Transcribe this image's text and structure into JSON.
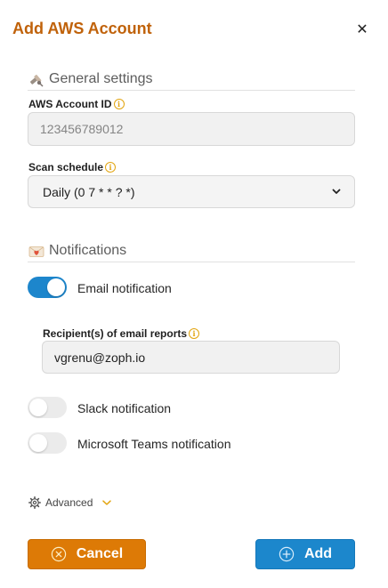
{
  "modal": {
    "title": "Add AWS Account",
    "close_label": "✕"
  },
  "general": {
    "heading": "General settings",
    "icon": "satellite-icon",
    "account_id_label": "AWS Account ID",
    "account_id_value": "123456789012",
    "scan_schedule_label": "Scan schedule",
    "scan_schedule_value": "Daily (0 7 * * ? *)"
  },
  "notifications": {
    "heading": "Notifications",
    "icon": "envelope-heart-icon",
    "email": {
      "label": "Email notification",
      "enabled": true
    },
    "recipients_label": "Recipient(s) of email reports",
    "recipients_value": "vgrenu@zoph.io",
    "slack": {
      "label": "Slack notification",
      "enabled": false
    },
    "teams": {
      "label": "Microsoft Teams notification",
      "enabled": false
    }
  },
  "advanced": {
    "label": "Advanced"
  },
  "buttons": {
    "cancel_label": "Cancel",
    "add_label": "Add"
  },
  "colors": {
    "title": "#c0620a",
    "cancel": "#dd7a06",
    "add": "#1c87cc",
    "toggle_on": "#1d86cc",
    "info": "#e2a40f"
  }
}
